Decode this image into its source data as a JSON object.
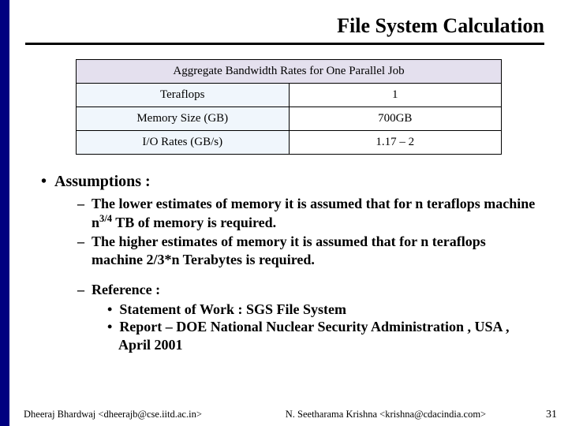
{
  "title": "File System Calculation",
  "table": {
    "header": "Aggregate Bandwidth Rates for One Parallel Job",
    "rows": [
      {
        "label": "Teraflops",
        "value": "1"
      },
      {
        "label": "Memory Size (GB)",
        "value": "700GB"
      },
      {
        "label": "I/O Rates (GB/s)",
        "value": "1.17 – 2"
      }
    ]
  },
  "assumptions_heading": "Assumptions :",
  "assumption1_pre": "The lower estimates of memory it is assumed that for n teraflops machine n",
  "assumption1_sup": "3/4",
  "assumption1_post": " TB of memory is required.",
  "assumption2": "The higher estimates of memory it is assumed that for n teraflops machine 2/3*n Terabytes is required.",
  "reference_heading": "Reference :",
  "ref1": "Statement of Work : SGS File System",
  "ref2": "Report – DOE National Nuclear Security Administration , USA , April 2001",
  "footer": {
    "left": "Dheeraj Bhardwaj <dheerajb@cse.iitd.ac.in>",
    "mid": "N. Seetharama Krishna <krishna@cdacindia.com>",
    "page": "31"
  }
}
